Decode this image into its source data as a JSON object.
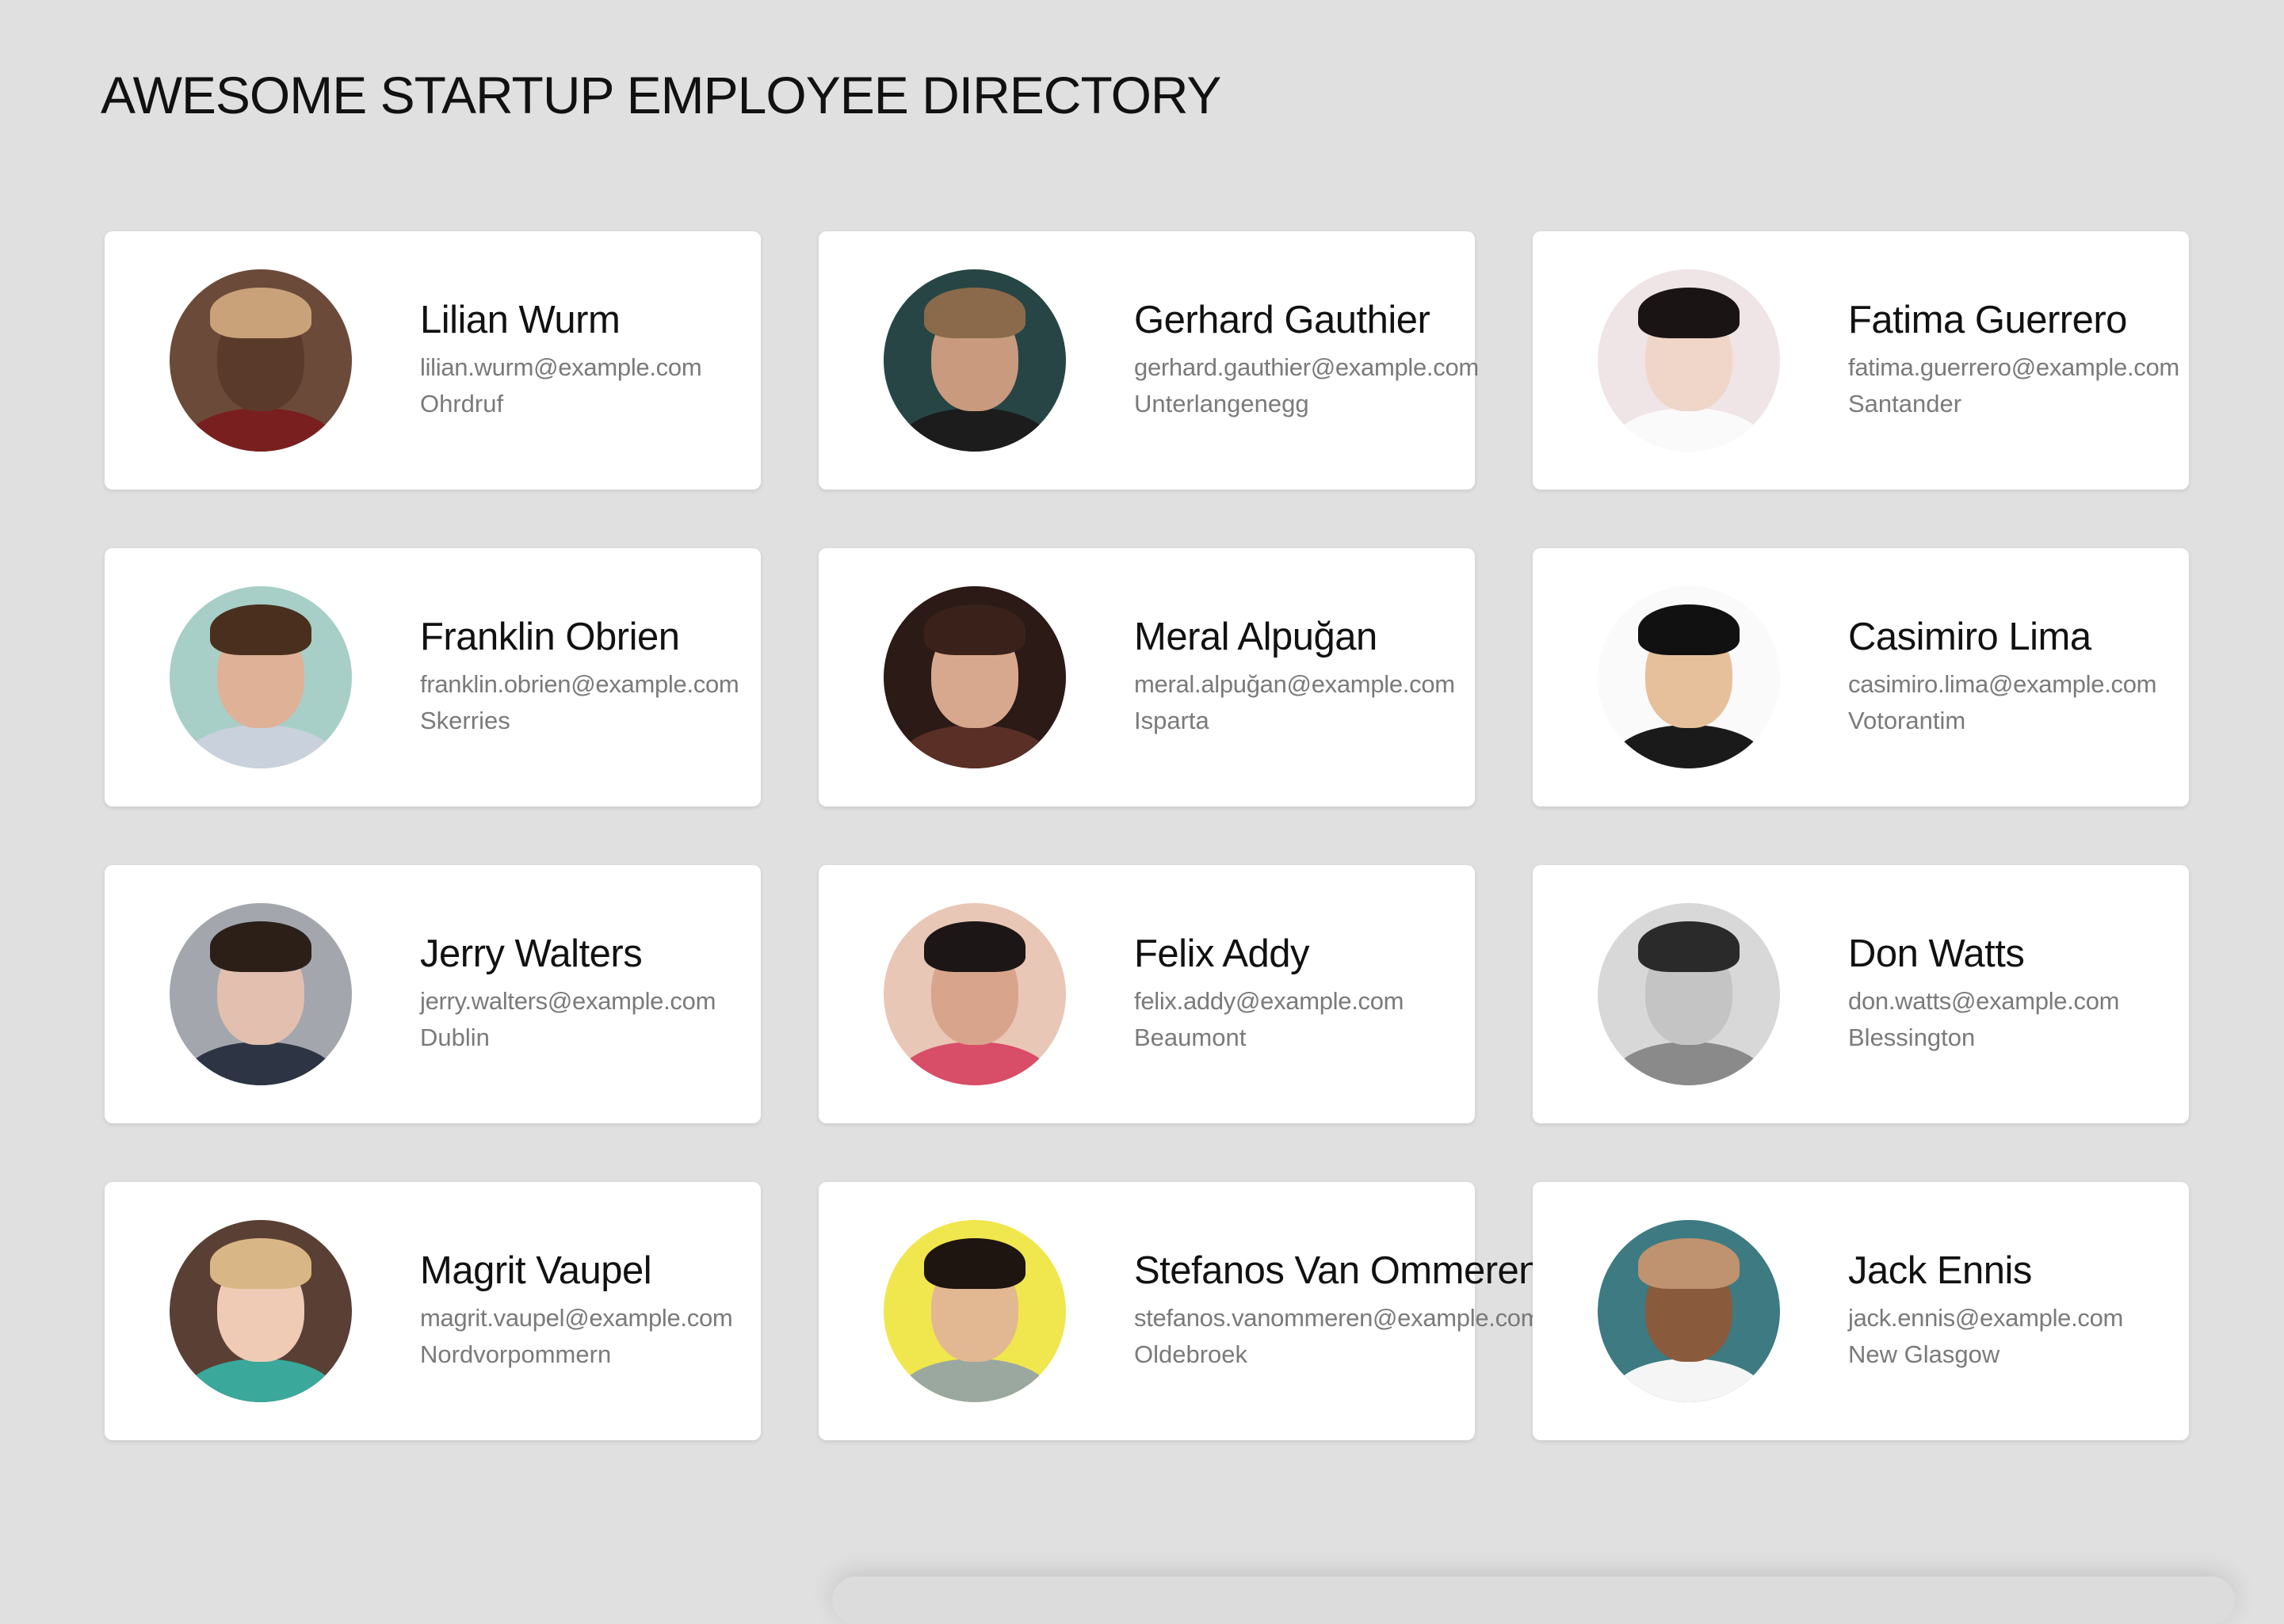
{
  "header": {
    "title": "AWESOME STARTUP EMPLOYEE DIRECTORY"
  },
  "employees": [
    {
      "name": "Lilian Wurm",
      "email": "lilian.wurm@example.com",
      "location": "Ohrdruf",
      "avatar": {
        "bg": "#6b4a3a",
        "skin": "#5a3a2a",
        "hair": "#c9a27a",
        "shirt": "#7a1f1f"
      }
    },
    {
      "name": "Gerhard Gauthier",
      "email": "gerhard.gauthier@example.com",
      "location": "Unterlangenegg",
      "avatar": {
        "bg": "#274545",
        "skin": "#c99a7e",
        "hair": "#8a6a4a",
        "shirt": "#1c1c1c"
      }
    },
    {
      "name": "Fatima Guerrero",
      "email": "fatima.guerrero@example.com",
      "location": "Santander",
      "avatar": {
        "bg": "#efe4e6",
        "skin": "#f0d6c8",
        "hair": "#1a1414",
        "shirt": "#fafafa"
      }
    },
    {
      "name": "Franklin Obrien",
      "email": "franklin.obrien@example.com",
      "location": "Skerries",
      "avatar": {
        "bg": "#a7cfc7",
        "skin": "#dfb197",
        "hair": "#4a2f1f",
        "shirt": "#c9d1dc"
      }
    },
    {
      "name": "Meral Alpuğan",
      "email": "meral.alpuğan@example.com",
      "location": "Isparta",
      "avatar": {
        "bg": "#2b1a16",
        "skin": "#d8a88e",
        "hair": "#3a221a",
        "shirt": "#5a2f25"
      }
    },
    {
      "name": "Casimiro Lima",
      "email": "casimiro.lima@example.com",
      "location": "Votorantim",
      "avatar": {
        "bg": "#fafafa",
        "skin": "#e6c09b",
        "hair": "#111111",
        "shirt": "#1a1a1a"
      }
    },
    {
      "name": "Jerry Walters",
      "email": "jerry.walters@example.com",
      "location": "Dublin",
      "avatar": {
        "bg": "#a3a6ad",
        "skin": "#e2bfae",
        "hair": "#2b1f18",
        "shirt": "#2d3544"
      }
    },
    {
      "name": "Felix Addy",
      "email": "felix.addy@example.com",
      "location": "Beaumont",
      "avatar": {
        "bg": "#e9c7b6",
        "skin": "#d9a48c",
        "hair": "#1c1616",
        "shirt": "#d84d68"
      }
    },
    {
      "name": "Don Watts",
      "email": "don.watts@example.com",
      "location": "Blessington",
      "avatar": {
        "bg": "#d8d8d8",
        "skin": "#c4c4c4",
        "hair": "#2a2a2a",
        "shirt": "#8a8a8a"
      }
    },
    {
      "name": "Magrit Vaupel",
      "email": "magrit.vaupel@example.com",
      "location": "Nordvorpommern",
      "avatar": {
        "bg": "#5a4034",
        "skin": "#efcbb6",
        "hair": "#d9b685",
        "shirt": "#3aa89a"
      }
    },
    {
      "name": "Stefanos Van Ommeren",
      "email": "stefanos.vanommeren@example.com",
      "location": "Oldebroek",
      "avatar": {
        "bg": "#f0e64e",
        "skin": "#e1b892",
        "hair": "#1e1410",
        "shirt": "#9aa8a0"
      }
    },
    {
      "name": "Jack Ennis",
      "email": "jack.ennis@example.com",
      "location": "New Glasgow",
      "avatar": {
        "bg": "#3d7a82",
        "skin": "#8a5a3c",
        "hair": "#bf936f",
        "shirt": "#f5f5f5"
      }
    }
  ]
}
